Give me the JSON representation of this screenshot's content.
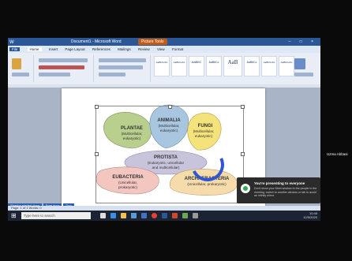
{
  "word": {
    "window_title": "Document1 - Microsoft Word",
    "share_label": "Picture Tools",
    "quick_access": "W",
    "window_controls": "– □ ×",
    "tabs": [
      "File",
      "Home",
      "Insert",
      "Page Layout",
      "References",
      "Mailings",
      "Review",
      "View",
      "Format"
    ],
    "styles": [
      "AaBbCcDc",
      "AaBbCcDc",
      "AaBbC",
      "AaBbCc",
      "AaB",
      "AaBbCc",
      "AaBbCcDc",
      "AaBbCcDc"
    ],
    "status_text": "Page: 1 of 1   Words: 0"
  },
  "diagram": {
    "plantae": {
      "title": "PLANTAE",
      "line1": "(Multicellular,",
      "line2": "eukaryotic)"
    },
    "animalia": {
      "title": "ANIMALIA",
      "line1": "(Multicellular,",
      "line2": "eukaryotic)"
    },
    "fungi": {
      "title": "FUNGI",
      "line1": "(Multicellular,",
      "line2": "eukaryotic)"
    },
    "protista": {
      "title": "PROTISTA",
      "line1": "(Eukaryotic, unicellular",
      "line2": "and multicellular)"
    },
    "eubacteria": {
      "title": "EUBACTERIA",
      "line1": "(Unicellular,",
      "line2": "prokaryotic)"
    },
    "archaebacteria": {
      "title": "ARCHAEBACTERIA",
      "line1": "(Unicellular, prokaryotic)"
    }
  },
  "taskbar": {
    "search_placeholder": "Type here to search",
    "time": "10:45",
    "date": "12/5/2020"
  },
  "downloads": [
    "Sharing started.docx",
    "Free.docx",
    "Doc"
  ],
  "toast": {
    "title": "You're presenting to everyone",
    "body": "Don't show your Meet window to the people in the meeting, switch to another window or tab to avoid an infinity mirror"
  },
  "participant": {
    "name": "Uzma Abbasi"
  },
  "colors": {
    "plantae": "#b8cf8d",
    "animalia": "#a8c6df",
    "fungi": "#f4e27a",
    "protista": "#c7c4dc",
    "eubacteria": "#f3c6c0",
    "archaebacteria": "#f6dcab"
  }
}
